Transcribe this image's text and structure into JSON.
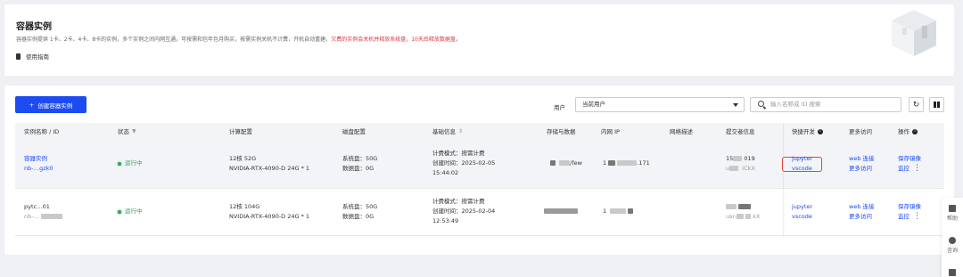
{
  "header": {
    "title": "容器实例",
    "description": "容器实例提供 1卡、2卡、4卡、8卡的实例，多个实例之间内网互通，可按需和包年包月购买，按需实例关机不计费，开机自动重建。",
    "warning": "欠费的实例会关机并释放系统盘，10天后释放数据盘。",
    "guide_label": "使用指南"
  },
  "toolbar": {
    "create_label": "创建容器实例",
    "user_label": "用户",
    "user_value": "当前用户",
    "search_placeholder": "输入名称或 ID 搜索",
    "refresh_icon": "refresh-icon",
    "settings_icon": "column-settings-icon"
  },
  "table": {
    "columns": {
      "name": "实例名称 / ID",
      "status": "状态",
      "compute": "计算配置",
      "disk": "磁盘配置",
      "basic": "基础信息",
      "storage": "存储与数据",
      "ip": "内网 IP",
      "net_desc": "网络描述",
      "submitter": "提交者信息",
      "quick_dev": "快捷开发",
      "more_access": "更多访问",
      "actions": "操作"
    },
    "rows": [
      {
        "name": "容器实例",
        "id": "nb-…gzk0",
        "status": "运行中",
        "compute_cpu": "12核 52G",
        "compute_gpu": "NVIDIA-RTX-4090-D 24G * 1",
        "sys_disk": "系统盘：50G",
        "data_disk": "数据盘：0G",
        "billing": "计费模式：按需计费",
        "created_label": "创建时间：2025-02-05",
        "created_time": "15:44:02",
        "storage": "/few",
        "ip_prefix": "1",
        "ip_suffix": ".171",
        "submitter_a": "15",
        "submitter_b": "019",
        "submitter_c": "u",
        "submitter_d": "iCkX",
        "quick_1": "jupyter",
        "quick_2": "vscode",
        "more_1": "web 连接",
        "more_2": "更多访问",
        "action_1": "保存镜像",
        "action_2": "监控"
      },
      {
        "name": "pytc…01",
        "id": "nb-…",
        "status": "运行中",
        "compute_cpu": "12核 104G",
        "compute_gpu": "NVIDIA-RTX-4090-D 24G * 1",
        "sys_disk": "系统盘：50G",
        "data_disk": "数据盘：0G",
        "billing": "计费模式：按需计费",
        "created_label": "创建时间：2025-02-04",
        "created_time": "12:53:49",
        "ip_prefix": "1",
        "submitter_c": "usr-",
        "submitter_d": "kX",
        "quick_1": "jupyter",
        "quick_2": "vscode",
        "more_1": "web 连接",
        "more_2": "更多访问",
        "action_1": "保存镜像",
        "action_2": "监控"
      }
    ]
  },
  "side_tools": {
    "help": "帮助",
    "consult": "咨询"
  },
  "colors": {
    "primary": "#1d4bf2",
    "running": "#2f9e58",
    "warning": "#d9363e"
  }
}
